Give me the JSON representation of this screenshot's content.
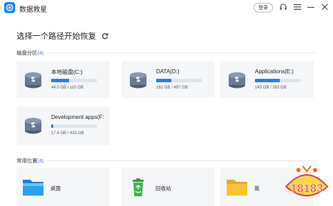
{
  "app": {
    "title": "数据救星",
    "login_label": "登录"
  },
  "heading": "选择一个路径开始恢复",
  "disk_section": {
    "label": "磁盘分区",
    "count": "(4)"
  },
  "drives": [
    {
      "name": "本地磁盘(C:)",
      "size": "44.0 GB / 110 GB",
      "usage": 0.4
    },
    {
      "name": "DATA(D:)",
      "size": "162 GB / 497 GB",
      "usage": 0.33
    },
    {
      "name": "Applications(E:)",
      "size": "143 GB / 263 GB",
      "usage": 0.54
    },
    {
      "name": "Development apps(F:",
      "size": "17.4 GB / 433 GB",
      "usage": 0.05
    }
  ],
  "common_section": {
    "label": "常用位置",
    "count": "(4)"
  },
  "locations": [
    {
      "label": "桌面",
      "icon": "desktop-folder-icon"
    },
    {
      "label": "回收站",
      "icon": "recycle-bin-icon"
    },
    {
      "label": "我",
      "icon": "folder-icon"
    }
  ],
  "watermark": {
    "text": "18183"
  },
  "colors": {
    "accent": "#2f7be6",
    "card_bg": "#f5f6f8",
    "bar_bg": "#dfe3ea"
  }
}
